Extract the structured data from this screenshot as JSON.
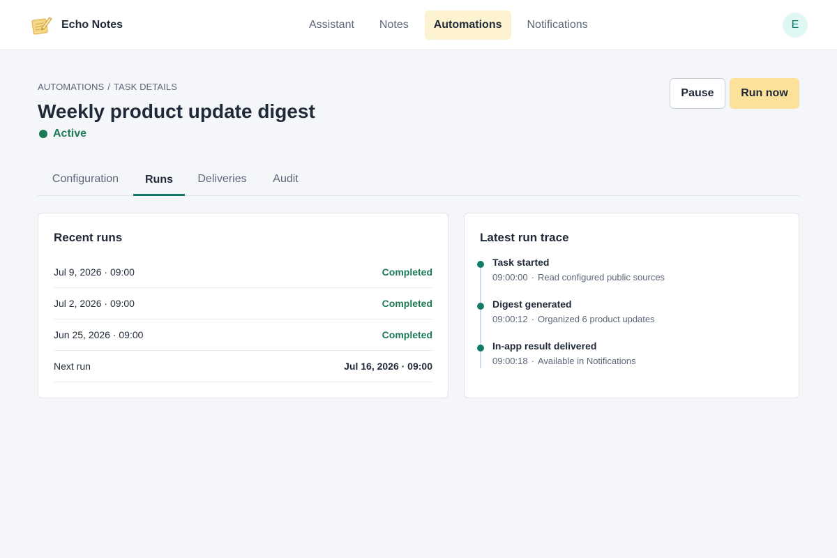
{
  "app": {
    "name": "Echo Notes",
    "logo_icon": "notepad-pencil-icon"
  },
  "nav": {
    "items": [
      {
        "label": "Assistant",
        "active": false
      },
      {
        "label": "Notes",
        "active": false
      },
      {
        "label": "Automations",
        "active": true
      },
      {
        "label": "Notifications",
        "active": false
      }
    ]
  },
  "user": {
    "avatar_initial": "E"
  },
  "breadcrumb": {
    "parent": "AUTOMATIONS",
    "separator": "/",
    "current": "TASK DETAILS"
  },
  "page": {
    "title": "Weekly product update digest",
    "status": "Active"
  },
  "actions": {
    "pause_label": "Pause",
    "run_now_label": "Run now"
  },
  "tabs": [
    {
      "label": "Configuration",
      "active": false
    },
    {
      "label": "Runs",
      "active": true
    },
    {
      "label": "Deliveries",
      "active": false
    },
    {
      "label": "Audit",
      "active": false
    }
  ],
  "recent_runs": {
    "title": "Recent runs",
    "rows": [
      {
        "date": "Jul 9, 2026 · 09:00",
        "status": "Completed"
      },
      {
        "date": "Jul 2, 2026 · 09:00",
        "status": "Completed"
      },
      {
        "date": "Jun 25, 2026 · 09:00",
        "status": "Completed"
      }
    ],
    "next_run": {
      "label": "Next run",
      "value": "Jul 16, 2026 · 09:00"
    }
  },
  "trace": {
    "title": "Latest run trace",
    "steps": [
      {
        "title": "Task started",
        "time": "09:00:00",
        "detail": "Read configured public sources"
      },
      {
        "title": "Digest generated",
        "time": "09:00:12",
        "detail": "Organized 6 product updates"
      },
      {
        "title": "In-app result delivered",
        "time": "09:00:18",
        "detail": "Available in Notifications"
      }
    ]
  },
  "colors": {
    "accent": "#137a6a",
    "success": "#1d7a54",
    "nav_active_bg": "#fdf3d0",
    "primary_button": "#fbe19a",
    "page_bg": "#f4f6fa"
  }
}
